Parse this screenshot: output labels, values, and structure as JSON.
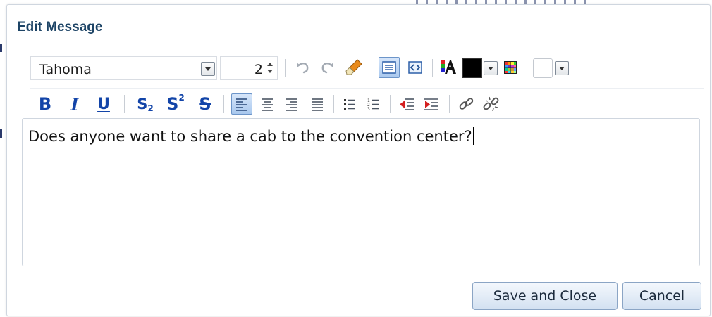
{
  "dialog": {
    "title": "Edit Message",
    "footer": {
      "save_label": "Save and Close",
      "cancel_label": "Cancel"
    }
  },
  "toolbar": {
    "font_family": "Tahoma",
    "font_size": "2",
    "bold": "B",
    "italic": "I",
    "underline": "U",
    "subscript": "S",
    "subscript_sub": "2",
    "superscript": "S",
    "superscript_sup": "2",
    "strikethrough": "S",
    "text_color": "#000000",
    "highlight_color": "#ffffff",
    "active_view": "rich-text",
    "active_alignment": "left"
  },
  "editor": {
    "content": "Does anyone want to share a cab to the convention center?"
  },
  "colors": {
    "accent": "#1244a8",
    "title": "#1d4466",
    "button_bg": "#d3e1f1"
  }
}
